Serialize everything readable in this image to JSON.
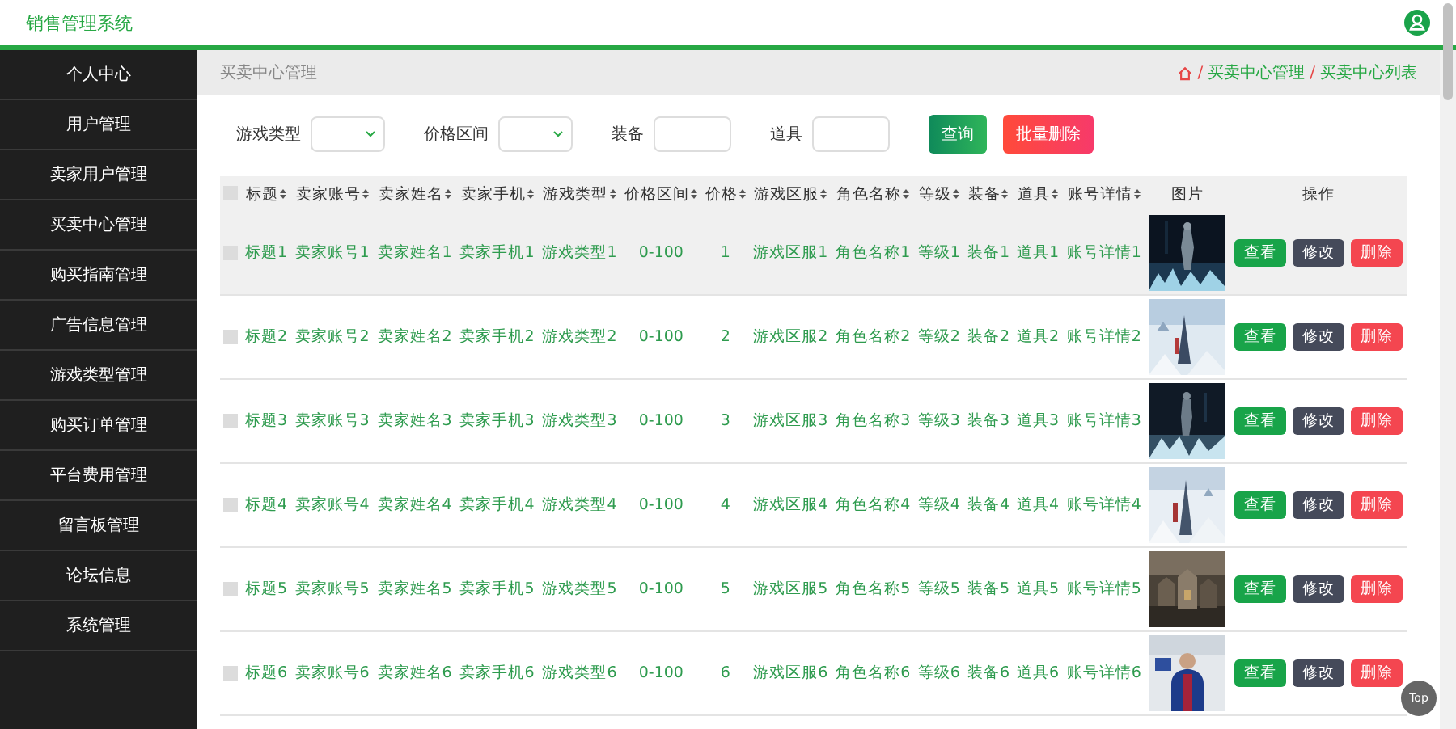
{
  "header": {
    "title": "销售管理系统"
  },
  "sidebar": {
    "items": [
      {
        "label": "个人中心",
        "selected": false
      },
      {
        "label": "用户管理",
        "selected": false
      },
      {
        "label": "卖家用户管理",
        "selected": false
      },
      {
        "label": "买卖中心管理",
        "selected": false
      },
      {
        "label": "购买指南管理",
        "selected": false
      },
      {
        "label": "广告信息管理",
        "selected": false
      },
      {
        "label": "游戏类型管理",
        "selected": false
      },
      {
        "label": "购买订单管理",
        "selected": false
      },
      {
        "label": "平台费用管理",
        "selected": false
      },
      {
        "label": "留言板管理",
        "selected": false
      },
      {
        "label": "论坛信息",
        "selected": false
      },
      {
        "label": "系统管理",
        "selected": false
      }
    ]
  },
  "breadcrumb": {
    "title": "买卖中心管理",
    "separator": "/",
    "trail": [
      "买卖中心管理",
      "买卖中心列表"
    ]
  },
  "filters": [
    {
      "kind": "select",
      "label": "游戏类型"
    },
    {
      "kind": "select",
      "label": "价格区间"
    },
    {
      "kind": "input",
      "label": "装备"
    },
    {
      "kind": "input",
      "label": "道具"
    }
  ],
  "actions": [
    {
      "kind": "primary",
      "label": "查询"
    },
    {
      "kind": "danger",
      "label": "批量删除"
    }
  ],
  "table": {
    "select_all": {
      "checked": false
    },
    "columns": [
      {
        "label": "标题",
        "sortable": true
      },
      {
        "label": "卖家账号",
        "sortable": true
      },
      {
        "label": "卖家姓名",
        "sortable": true
      },
      {
        "label": "卖家手机",
        "sortable": true
      },
      {
        "label": "游戏类型",
        "sortable": true
      },
      {
        "label": "价格区间",
        "sortable": true
      },
      {
        "label": "价格",
        "sortable": true
      },
      {
        "label": "游戏区服",
        "sortable": true
      },
      {
        "label": "角色名称",
        "sortable": true
      },
      {
        "label": "等级",
        "sortable": true
      },
      {
        "label": "装备",
        "sortable": true
      },
      {
        "label": "道具",
        "sortable": true
      },
      {
        "label": "账号详情",
        "sortable": true
      },
      {
        "label": "图片",
        "sortable": false
      },
      {
        "label": "操作",
        "sortable": false
      }
    ],
    "rows": [
      {
        "checked": false,
        "highlighted": true,
        "cells": [
          "标题1",
          "卖家账号1",
          "卖家姓名1",
          "卖家手机1",
          "游戏类型1",
          "0-100",
          "1",
          "游戏区服1",
          "角色名称1",
          "等级1",
          "装备1",
          "道具1",
          "账号详情1"
        ],
        "picture": {
          "kind": "picture"
        },
        "buttons": [
          {
            "kind": "view",
            "label": "查看"
          },
          {
            "kind": "edit",
            "label": "修改"
          },
          {
            "kind": "delete",
            "label": "删除"
          }
        ]
      },
      {
        "checked": false,
        "highlighted": false,
        "cells": [
          "标题2",
          "卖家账号2",
          "卖家姓名2",
          "卖家手机2",
          "游戏类型2",
          "0-100",
          "2",
          "游戏区服2",
          "角色名称2",
          "等级2",
          "装备2",
          "道具2",
          "账号详情2"
        ],
        "picture": {
          "kind": "picture"
        },
        "buttons": [
          {
            "kind": "view",
            "label": "查看"
          },
          {
            "kind": "edit",
            "label": "修改"
          },
          {
            "kind": "delete",
            "label": "删除"
          }
        ]
      },
      {
        "checked": false,
        "highlighted": false,
        "cells": [
          "标题3",
          "卖家账号3",
          "卖家姓名3",
          "卖家手机3",
          "游戏类型3",
          "0-100",
          "3",
          "游戏区服3",
          "角色名称3",
          "等级3",
          "装备3",
          "道具3",
          "账号详情3"
        ],
        "picture": {
          "kind": "picture"
        },
        "buttons": [
          {
            "kind": "view",
            "label": "查看"
          },
          {
            "kind": "edit",
            "label": "修改"
          },
          {
            "kind": "delete",
            "label": "删除"
          }
        ]
      },
      {
        "checked": false,
        "highlighted": false,
        "cells": [
          "标题4",
          "卖家账号4",
          "卖家姓名4",
          "卖家手机4",
          "游戏类型4",
          "0-100",
          "4",
          "游戏区服4",
          "角色名称4",
          "等级4",
          "装备4",
          "道具4",
          "账号详情4"
        ],
        "picture": {
          "kind": "picture"
        },
        "buttons": [
          {
            "kind": "view",
            "label": "查看"
          },
          {
            "kind": "edit",
            "label": "修改"
          },
          {
            "kind": "delete",
            "label": "删除"
          }
        ]
      },
      {
        "checked": false,
        "highlighted": false,
        "cells": [
          "标题5",
          "卖家账号5",
          "卖家姓名5",
          "卖家手机5",
          "游戏类型5",
          "0-100",
          "5",
          "游戏区服5",
          "角色名称5",
          "等级5",
          "装备5",
          "道具5",
          "账号详情5"
        ],
        "picture": {
          "kind": "picture"
        },
        "buttons": [
          {
            "kind": "view",
            "label": "查看"
          },
          {
            "kind": "edit",
            "label": "修改"
          },
          {
            "kind": "delete",
            "label": "删除"
          }
        ]
      },
      {
        "checked": false,
        "highlighted": false,
        "cells": [
          "标题6",
          "卖家账号6",
          "卖家姓名6",
          "卖家手机6",
          "游戏类型6",
          "0-100",
          "6",
          "游戏区服6",
          "角色名称6",
          "等级6",
          "装备6",
          "道具6",
          "账号详情6"
        ],
        "picture": {
          "kind": "picture"
        },
        "buttons": [
          {
            "kind": "view",
            "label": "查看"
          },
          {
            "kind": "edit",
            "label": "修改"
          },
          {
            "kind": "delete",
            "label": "删除"
          }
        ]
      }
    ]
  },
  "top_button": {
    "label": "Top"
  }
}
